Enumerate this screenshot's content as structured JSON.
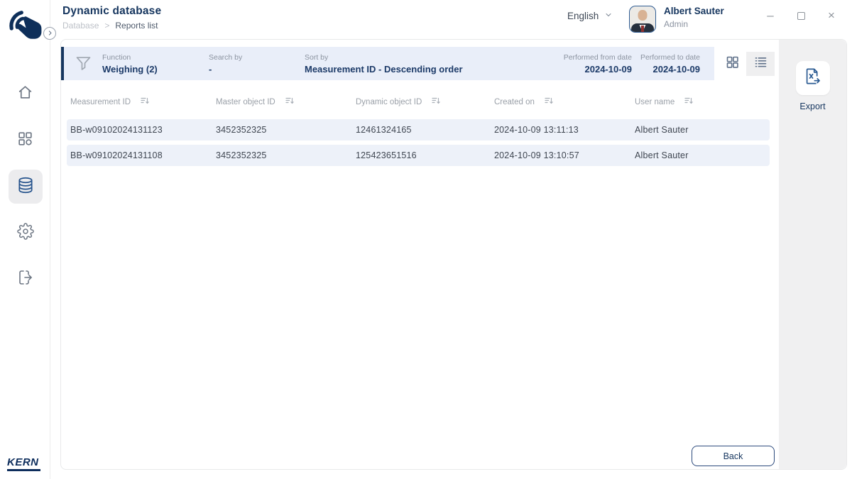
{
  "colors": {
    "navy_text": "#15355e",
    "logo_navy": "#0e2f5a",
    "icon_blue": "#27548d",
    "filter_bar_bg": "#e9eef9",
    "row_bg": "#edf1f9",
    "panel_bg": "#f0f0f1",
    "muted_label": "#8b93a0"
  },
  "header": {
    "title": "Dynamic database",
    "breadcrumb": {
      "parent": "Database",
      "separator": ">",
      "current": "Reports list"
    },
    "language": {
      "selected": "English"
    },
    "user": {
      "name": "Albert Sauter",
      "role": "Admin"
    }
  },
  "window_controls": {
    "minimize": "–",
    "close": "×"
  },
  "sidebar": {
    "brand": "KERN",
    "items": [
      {
        "id": "home",
        "active": false
      },
      {
        "id": "functions",
        "active": false
      },
      {
        "id": "database",
        "active": true
      },
      {
        "id": "settings",
        "active": false
      },
      {
        "id": "logout",
        "active": false
      }
    ]
  },
  "filter": {
    "fields": [
      {
        "label": "Function",
        "value": "Weighing (2)"
      },
      {
        "label": "Search by",
        "value": "-"
      },
      {
        "label": "Sort by",
        "value": "Measurement ID - Descending order"
      },
      {
        "label": "Performed from date",
        "value": "2024-10-09"
      },
      {
        "label": "Performed to date",
        "value": "2024-10-09"
      }
    ]
  },
  "export": {
    "label": "Export"
  },
  "table": {
    "columns": [
      "Measurement ID",
      "Master object ID",
      "Dynamic object ID",
      "Created on",
      "User name"
    ],
    "rows": [
      [
        "BB-w09102024131123",
        "3452352325",
        "12461324165",
        "2024-10-09 13:11:13",
        "Albert Sauter"
      ],
      [
        "BB-w09102024131108",
        "3452352325",
        "125423651516",
        "2024-10-09 13:10:57",
        "Albert Sauter"
      ]
    ]
  },
  "back": {
    "label": "Back"
  }
}
